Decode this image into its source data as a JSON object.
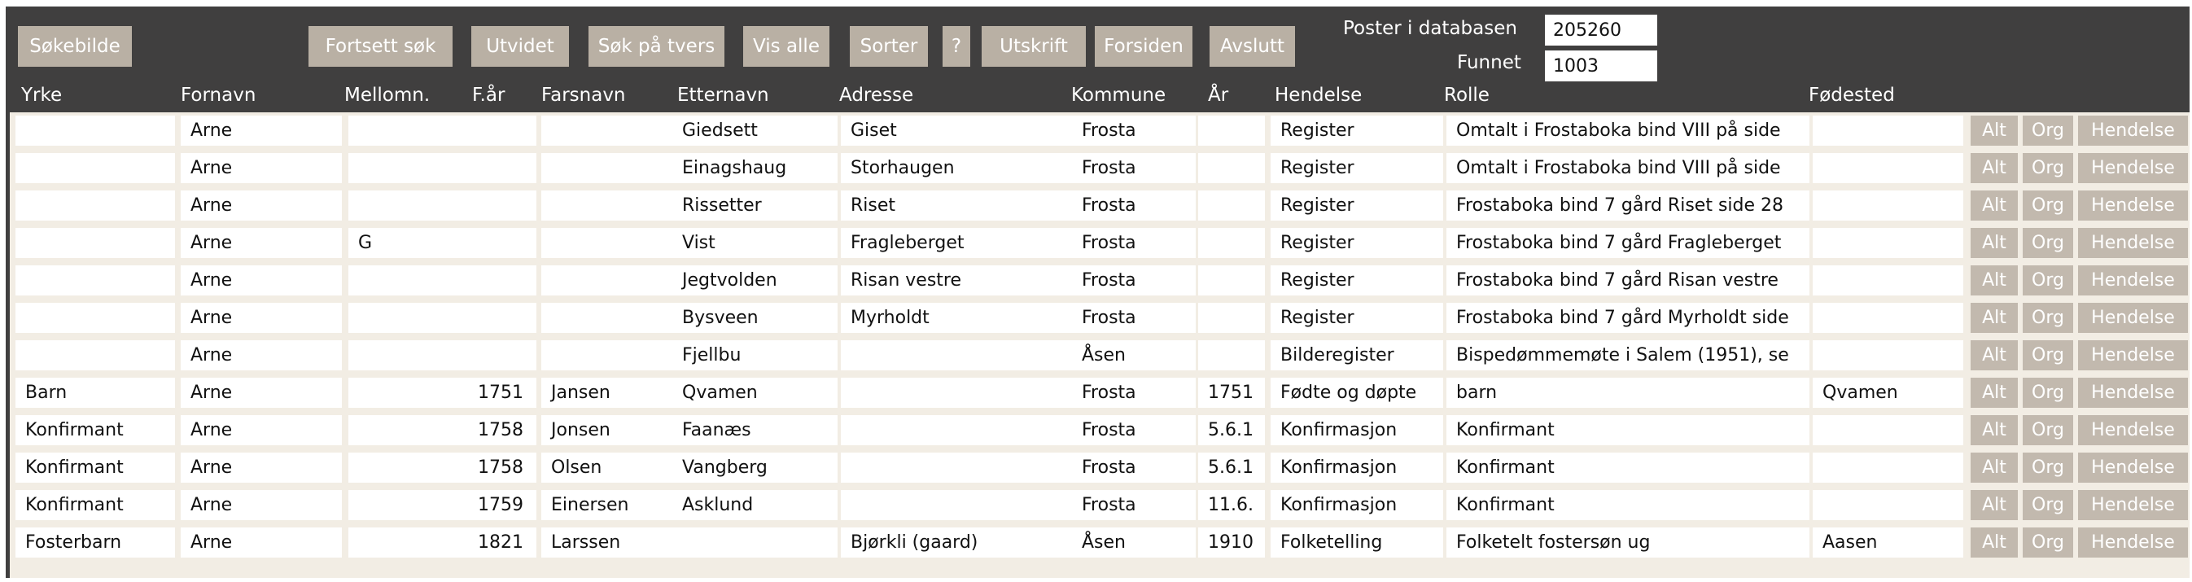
{
  "toolbar": {
    "buttons": [
      {
        "label": "Søkebilde"
      },
      {
        "label": "Fortsett søk"
      },
      {
        "label": "Utvidet"
      },
      {
        "label": "Søk på tvers"
      },
      {
        "label": "Vis alle"
      },
      {
        "label": "Sorter"
      },
      {
        "label": "?"
      },
      {
        "label": "Utskrift"
      },
      {
        "label": "Forsiden"
      },
      {
        "label": "Avslutt"
      }
    ]
  },
  "stats": {
    "records_label": "Poster i databasen",
    "records_value": "205260",
    "found_label": "Funnet",
    "found_value": "1003"
  },
  "columns": [
    "Yrke",
    "Fornavn",
    "Mellomn.",
    "F.år",
    "Farsnavn",
    "Etternavn",
    "Adresse",
    "Kommune",
    "År",
    "Hendelse",
    "Rolle",
    "Fødested"
  ],
  "row_buttons": {
    "alt": "Alt",
    "org": "Org",
    "event": "Hendelse"
  },
  "rows": [
    {
      "yrke": "",
      "fornavn": "Arne",
      "mellomn": "",
      "faar": "",
      "farsnavn": "",
      "etternavn": "Giedsett",
      "adresse": "Giset",
      "kommune": "Frosta",
      "aar": "",
      "hendelse": "Register",
      "rolle": "Omtalt i Frostaboka bind VIII på side",
      "fodested": ""
    },
    {
      "yrke": "",
      "fornavn": "Arne",
      "mellomn": "",
      "faar": "",
      "farsnavn": "",
      "etternavn": "Einagshaug",
      "adresse": "Storhaugen",
      "kommune": "Frosta",
      "aar": "",
      "hendelse": "Register",
      "rolle": "Omtalt i Frostaboka bind VIII på side",
      "fodested": ""
    },
    {
      "yrke": "",
      "fornavn": "Arne",
      "mellomn": "",
      "faar": "",
      "farsnavn": "",
      "etternavn": "Rissetter",
      "adresse": "Riset",
      "kommune": "Frosta",
      "aar": "",
      "hendelse": "Register",
      "rolle": "Frostaboka bind 7 gård Riset side 28",
      "fodested": ""
    },
    {
      "yrke": "",
      "fornavn": "Arne",
      "mellomn": "G",
      "faar": "",
      "farsnavn": "",
      "etternavn": "Vist",
      "adresse": "Fragleberget",
      "kommune": "Frosta",
      "aar": "",
      "hendelse": "Register",
      "rolle": "Frostaboka bind 7 gård Fragleberget",
      "fodested": ""
    },
    {
      "yrke": "",
      "fornavn": "Arne",
      "mellomn": "",
      "faar": "",
      "farsnavn": "",
      "etternavn": "Jegtvolden",
      "adresse": "Risan vestre",
      "kommune": "Frosta",
      "aar": "",
      "hendelse": "Register",
      "rolle": "Frostaboka bind 7 gård Risan vestre",
      "fodested": ""
    },
    {
      "yrke": "",
      "fornavn": "Arne",
      "mellomn": "",
      "faar": "",
      "farsnavn": "",
      "etternavn": "Bysveen",
      "adresse": "Myrholdt",
      "kommune": "Frosta",
      "aar": "",
      "hendelse": "Register",
      "rolle": "Frostaboka bind 7 gård Myrholdt side",
      "fodested": ""
    },
    {
      "yrke": "",
      "fornavn": "Arne",
      "mellomn": "",
      "faar": "",
      "farsnavn": "",
      "etternavn": "Fjellbu",
      "adresse": "",
      "kommune": "Åsen",
      "aar": "",
      "hendelse": "Bilderegister",
      "rolle": "Bispedømmemøte i Salem (1951), se",
      "fodested": ""
    },
    {
      "yrke": "Barn",
      "fornavn": "Arne",
      "mellomn": "",
      "faar": "1751",
      "farsnavn": "Jansen",
      "etternavn": "Qvamen",
      "adresse": "",
      "kommune": "Frosta",
      "aar": "1751",
      "hendelse": "Fødte og døpte",
      "rolle": "barn",
      "fodested": "Qvamen"
    },
    {
      "yrke": "Konfirmant",
      "fornavn": "Arne",
      "mellomn": "",
      "faar": "1758",
      "farsnavn": "Jonsen",
      "etternavn": "Faanæs",
      "adresse": "",
      "kommune": "Frosta",
      "aar": "5.6.1",
      "hendelse": "Konfirmasjon",
      "rolle": "Konfirmant",
      "fodested": ""
    },
    {
      "yrke": "Konfirmant",
      "fornavn": "Arne",
      "mellomn": "",
      "faar": "1758",
      "farsnavn": "Olsen",
      "etternavn": "Vangberg",
      "adresse": "",
      "kommune": "Frosta",
      "aar": "5.6.1",
      "hendelse": "Konfirmasjon",
      "rolle": "Konfirmant",
      "fodested": ""
    },
    {
      "yrke": "Konfirmant",
      "fornavn": "Arne",
      "mellomn": "",
      "faar": "1759",
      "farsnavn": "Einersen",
      "etternavn": "Asklund",
      "adresse": "",
      "kommune": "Frosta",
      "aar": "11.6.",
      "hendelse": "Konfirmasjon",
      "rolle": "Konfirmant",
      "fodested": ""
    },
    {
      "yrke": "Fosterbarn",
      "fornavn": "Arne",
      "mellomn": "",
      "faar": "1821",
      "farsnavn": "Larssen",
      "etternavn": "",
      "adresse": "Bjørkli (gaard)",
      "kommune": "Åsen",
      "aar": "1910",
      "hendelse": "Folketelling",
      "rolle": "Folketelt fostersøn ug",
      "fodested": "Aasen"
    }
  ]
}
